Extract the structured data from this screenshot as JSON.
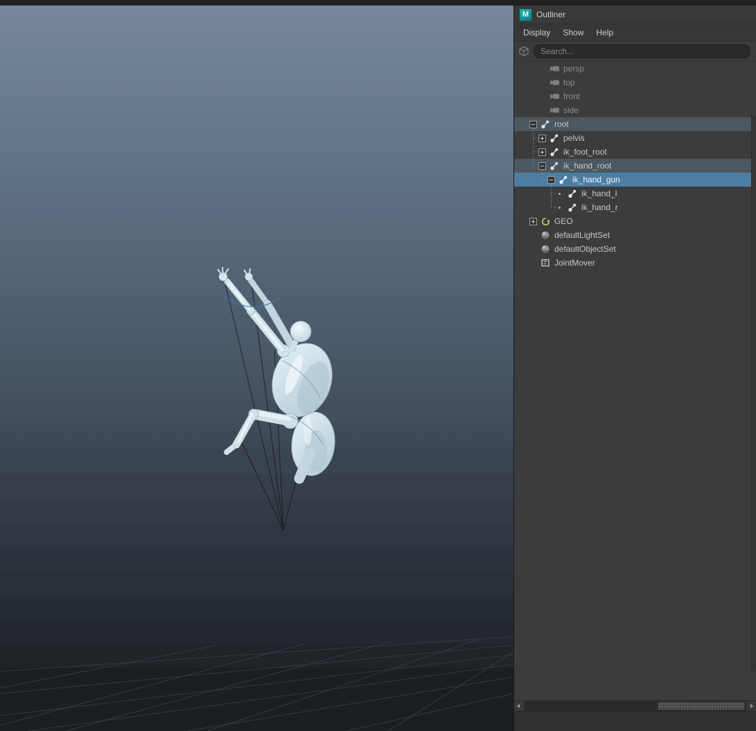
{
  "panel": {
    "logo_text": "M",
    "title": "Outliner",
    "menus": [
      {
        "label": "Display"
      },
      {
        "label": "Show"
      },
      {
        "label": "Help"
      }
    ],
    "search": {
      "placeholder": "Search..."
    }
  },
  "tree": {
    "items": [
      {
        "label": "persp",
        "icon": "camera",
        "depth": 1,
        "toggle": "none",
        "state": "grayed"
      },
      {
        "label": "top",
        "icon": "camera",
        "depth": 1,
        "toggle": "none",
        "state": "grayed"
      },
      {
        "label": "front",
        "icon": "camera",
        "depth": 1,
        "toggle": "none",
        "state": "grayed"
      },
      {
        "label": "side",
        "icon": "camera",
        "depth": 1,
        "toggle": "none",
        "state": "grayed"
      },
      {
        "label": "root",
        "icon": "joint",
        "depth": 0,
        "toggle": "minus",
        "state": "ancestor"
      },
      {
        "label": "pelvis",
        "icon": "joint",
        "depth": 1,
        "toggle": "plus",
        "state": "normal"
      },
      {
        "label": "ik_foot_root",
        "icon": "joint",
        "depth": 1,
        "toggle": "plus",
        "state": "normal"
      },
      {
        "label": "ik_hand_root",
        "icon": "joint",
        "depth": 1,
        "toggle": "minus",
        "state": "ancestor"
      },
      {
        "label": "ik_hand_gun",
        "icon": "joint",
        "depth": 2,
        "toggle": "minus",
        "state": "selected"
      },
      {
        "label": "ik_hand_l",
        "icon": "joint",
        "depth": 3,
        "toggle": "dot",
        "state": "normal"
      },
      {
        "label": "ik_hand_r",
        "icon": "joint",
        "depth": 3,
        "toggle": "dot",
        "state": "normal"
      },
      {
        "label": "GEO",
        "icon": "group",
        "depth": 0,
        "toggle": "plus",
        "state": "normal"
      },
      {
        "label": "defaultLightSet",
        "icon": "set",
        "depth": 0,
        "toggle": "none",
        "state": "normal"
      },
      {
        "label": "defaultObjectSet",
        "icon": "set",
        "depth": 0,
        "toggle": "none",
        "state": "normal"
      },
      {
        "label": "JointMover",
        "icon": "jointmover",
        "depth": 0,
        "toggle": "none",
        "state": "normal"
      }
    ]
  },
  "viewport": {
    "scene": "character rig in fall pose with IK lines converging below, perspective grid at bottom"
  },
  "colors": {
    "selection_blue": "#4e7da2",
    "ancestor_highlight": "#4b5761",
    "panel_bg": "#3c3c3c",
    "maya_teal": "#14a4a1",
    "model_skin": "#d3e3ec"
  }
}
